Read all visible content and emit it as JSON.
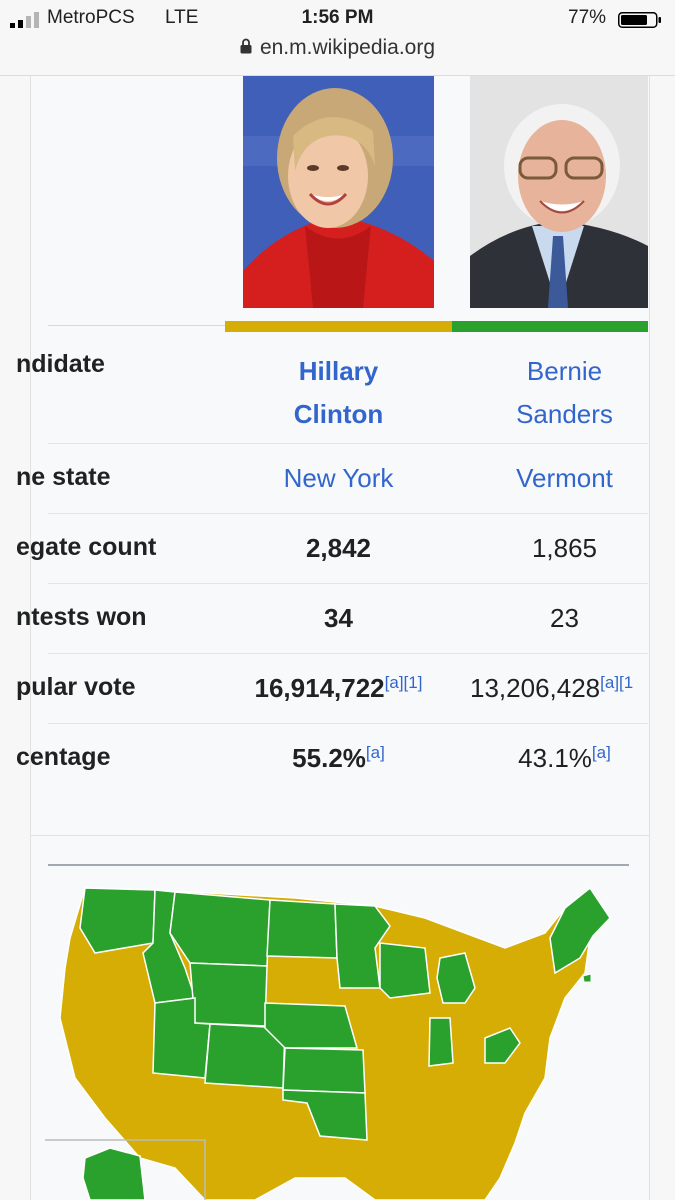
{
  "status_bar": {
    "carrier": "MetroPCS",
    "network": "LTE",
    "time": "1:56 PM",
    "battery": "77%",
    "battery_level": 0.77
  },
  "browser": {
    "url": "en.m.wikipedia.org"
  },
  "colors": {
    "clinton": "#d6ad04",
    "sanders": "#2aa12c",
    "link": "#3366cc"
  },
  "infobox": {
    "candidate_label": "ndidate",
    "candidates": [
      {
        "name_line1": "Hillary",
        "name_line2": "Clinton",
        "photo": "Hillary Clinton portrait"
      },
      {
        "name_line1": "Bernie",
        "name_line2": "Sanders",
        "photo": "Bernie Sanders portrait"
      }
    ],
    "rows": [
      {
        "label": "ne state",
        "values": [
          "New York",
          "Vermont"
        ]
      },
      {
        "label": "egate count",
        "values": [
          "2,842",
          "1,865"
        ]
      },
      {
        "label": "ntests won",
        "values": [
          "34",
          "23"
        ]
      },
      {
        "label": "pular vote",
        "values": [
          "16,914,722",
          "13,206,428"
        ],
        "refs": [
          "[a][1]",
          "[a][1"
        ]
      },
      {
        "label": "centage",
        "values": [
          "55.2%",
          "43.1%"
        ],
        "refs": [
          "[a]",
          "[a]"
        ]
      }
    ]
  },
  "map": {
    "legend_colors": {
      "clinton": "#d6ad04",
      "sanders": "#2aa12c"
    }
  }
}
